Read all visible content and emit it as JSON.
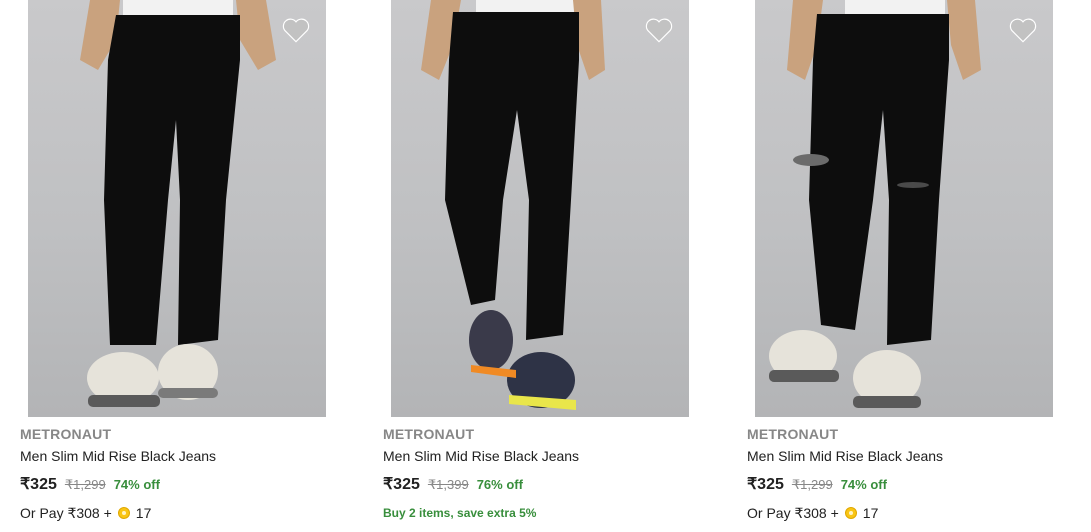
{
  "products": [
    {
      "brand": "METRONAUT",
      "title": "Men Slim Mid Rise Black Jeans",
      "price": "₹325",
      "mrp": "₹1,299",
      "discount": "74% off",
      "pay_text": "Or Pay ₹308 +",
      "coins": "17",
      "icons": [
        "heart-icon",
        "coin-icon"
      ]
    },
    {
      "brand": "METRONAUT",
      "title": "Men Slim Mid Rise Black Jeans",
      "price": "₹325",
      "mrp": "₹1,399",
      "discount": "76% off",
      "offer": "Buy 2 items, save extra 5%",
      "icons": [
        "heart-icon"
      ]
    },
    {
      "brand": "METRONAUT",
      "title": "Men Slim Mid Rise Black Jeans",
      "price": "₹325",
      "mrp": "₹1,299",
      "discount": "74% off",
      "pay_text": "Or Pay ₹308 +",
      "coins": "17",
      "icons": [
        "heart-icon",
        "coin-icon"
      ]
    }
  ],
  "colors": {
    "discount": "#388e3c",
    "brand": "#878787",
    "coin": "#f9c514"
  }
}
